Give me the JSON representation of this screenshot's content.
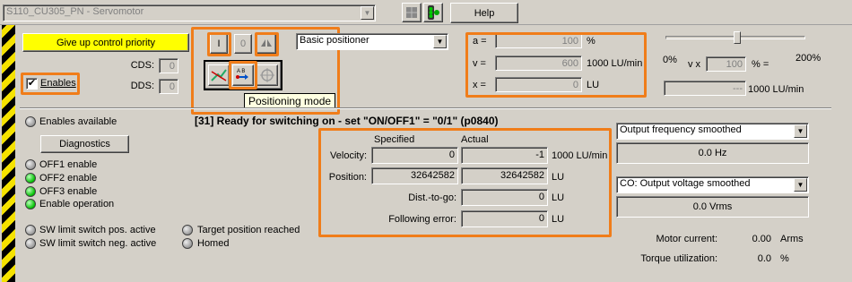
{
  "header": {
    "drive_select": "S110_CU305_PN - Servomotor",
    "help_label": "Help"
  },
  "control": {
    "give_up_label": "Give up control priority",
    "enables_label": "Enables",
    "enables_checked": "✔",
    "cds_label": "CDS:",
    "cds_value": "0",
    "dds_label": "DDS:",
    "dds_value": "0"
  },
  "toolbar": {
    "on_label": "I",
    "off_label": "0",
    "mode_select": "Basic positioner",
    "tooltip": "Positioning mode"
  },
  "setpoints": {
    "a_label": "a =",
    "a_value": "100",
    "a_unit": "%",
    "v_label": "v =",
    "v_value": "600",
    "v_unit": "1000 LU/min",
    "x_label": "x =",
    "x_value": "0",
    "x_unit": "LU"
  },
  "override": {
    "min_label": "0%",
    "vx_label": "v x",
    "value": "100",
    "pct_label": "% =",
    "max_label": "200%",
    "result_value": "---",
    "result_unit": "1000 LU/min",
    "level_percent": 40
  },
  "status": {
    "message": "[31] Ready for switching on - set \"ON/OFF1\" = \"0/1\" (p0840)",
    "enables_available": "Enables available",
    "diagnostics_label": "Diagnostics",
    "off1": "OFF1 enable",
    "off2": "OFF2 enable",
    "off3": "OFF3 enable",
    "enable_op": "Enable operation",
    "sw_pos": "SW limit switch pos. active",
    "sw_neg": "SW limit switch neg. active",
    "target_reached": "Target position reached",
    "homed": "Homed"
  },
  "position": {
    "specified_header": "Specified",
    "actual_header": "Actual",
    "velocity_label": "Velocity:",
    "velocity_specified": "0",
    "velocity_actual": "-1",
    "velocity_unit": "1000 LU/min",
    "position_label": "Position:",
    "position_specified": "32642582",
    "position_actual": "32642582",
    "position_unit": "LU",
    "dist_label": "Dist.-to-go:",
    "dist_value": "0",
    "dist_unit": "LU",
    "ferr_label": "Following error:",
    "ferr_value": "0",
    "ferr_unit": "LU"
  },
  "monitor": {
    "select1": "Output frequency smoothed",
    "value1": "0.0 Hz",
    "select2": "CO: Output voltage smoothed",
    "value2": "0.0 Vrms",
    "motor_current_label": "Motor current:",
    "motor_current_value": "0.00",
    "motor_current_unit": "Arms",
    "torque_label": "Torque utilization:",
    "torque_value": "0.0",
    "torque_unit": "%"
  },
  "colors": {
    "accent_highlight": "#f07d1a",
    "give_up_button": "#ffff00",
    "led_active": "#00c000"
  }
}
